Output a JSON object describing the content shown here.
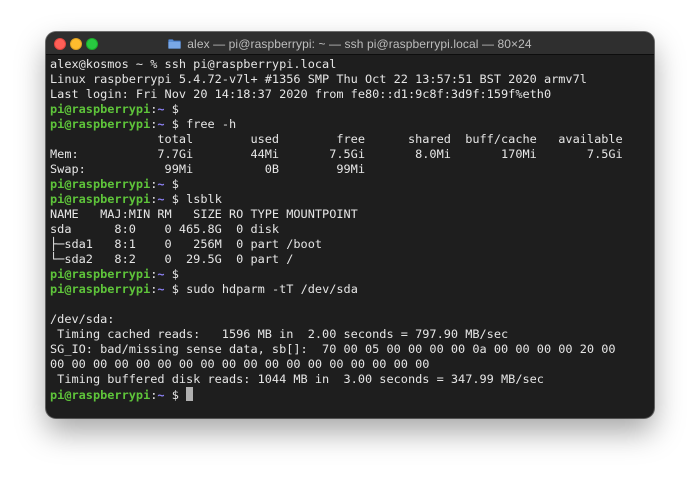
{
  "window": {
    "title": "alex — pi@raspberrypi: ~ — ssh pi@raspberrypi.local — 80×24"
  },
  "colors": {
    "background": "#1e1e1e",
    "user": "#5ec43a",
    "path": "#8a7ff0",
    "text": "#e6e6e6"
  },
  "terminal": {
    "line1": "alex@kosmos ~ % ssh pi@raspberrypi.local",
    "line2": "Linux raspberrypi 5.4.72-v7l+ #1356 SMP Thu Oct 22 13:57:51 BST 2020 armv7l",
    "line3": "Last login: Fri Nov 20 14:18:37 2020 from fe80::d1:9c8f:3d9f:159f%eth0",
    "prompt_user": "pi@raspberrypi",
    "prompt_path": "~",
    "prompt_colon": ":",
    "prompt_symbol": " $ ",
    "cmd_free": "free -h",
    "free_header": "               total        used        free      shared  buff/cache   available",
    "free_mem": "Mem:           7.7Gi        44Mi       7.5Gi       8.0Mi       170Mi       7.5Gi",
    "free_swap": "Swap:           99Mi          0B        99Mi",
    "cmd_lsblk": "lsblk",
    "lsblk_header": "NAME   MAJ:MIN RM   SIZE RO TYPE MOUNTPOINT",
    "lsblk_sda": "sda      8:0    0 465.8G  0 disk",
    "lsblk_sda1": "├─sda1   8:1    0   256M  0 part /boot",
    "lsblk_sda2": "└─sda2   8:2    0  29.5G  0 part /",
    "cmd_hdparm": "sudo hdparm -tT /dev/sda",
    "hd_dev": "/dev/sda:",
    "hd_cached": " Timing cached reads:   1596 MB in  2.00 seconds = 797.90 MB/sec",
    "hd_sgio1": "SG_IO: bad/missing sense data, sb[]:  70 00 05 00 00 00 00 0a 00 00 00 00 20 00",
    "hd_sgio2": "00 00 00 00 00 00 00 00 00 00 00 00 00 00 00 00 00 00",
    "hd_buffered": " Timing buffered disk reads: 1044 MB in  3.00 seconds = 347.99 MB/sec"
  }
}
